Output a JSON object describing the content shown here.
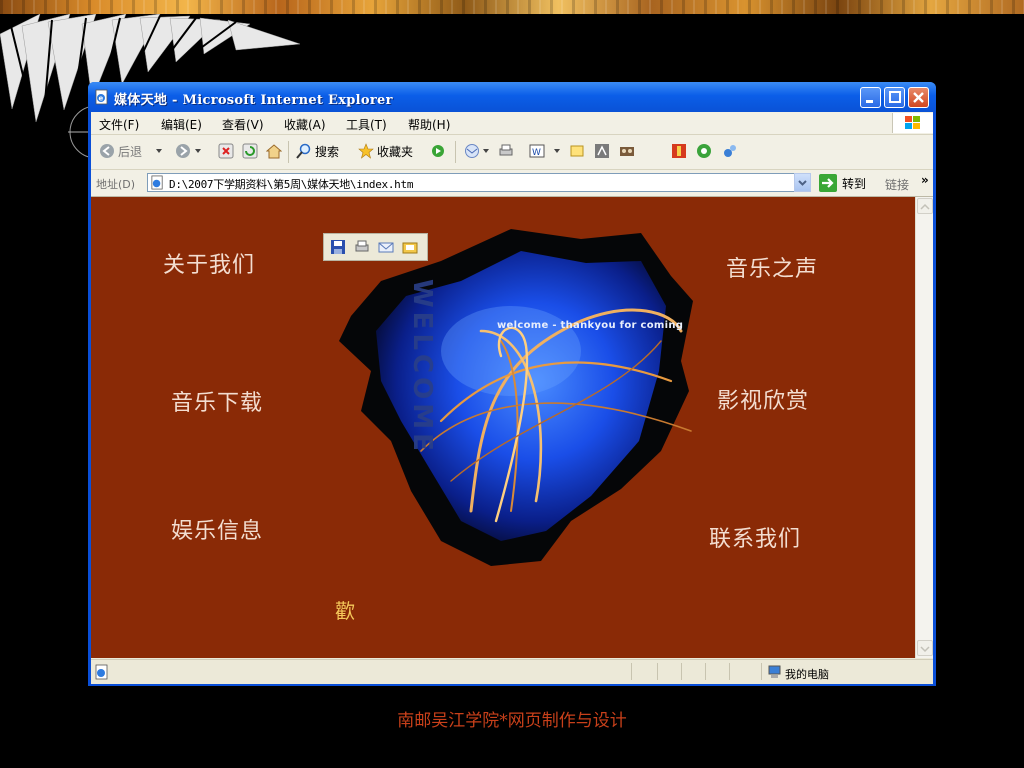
{
  "browser": {
    "title": "媒体天地 - Microsoft Internet Explorer",
    "menu": [
      "文件(F)",
      "编辑(E)",
      "查看(V)",
      "收藏(A)",
      "工具(T)",
      "帮助(H)"
    ],
    "toolbar": {
      "back_label": "后退",
      "search_label": "搜索",
      "favorites_label": "收藏夹"
    },
    "address": {
      "label": "地址(D)",
      "value": "D:\\2007下学期资料\\第5周\\媒体天地\\index.htm",
      "go_label": "转到",
      "links_label": "链接",
      "overflow": "»"
    },
    "status": {
      "zone": "我的电脑"
    }
  },
  "page": {
    "nav": [
      "关于我们",
      "音乐之声",
      "音乐下载",
      "影视欣赏",
      "娱乐信息",
      "联系我们"
    ],
    "welcome_caption": "welcome - thankyou for coming",
    "welcome_vertical": "WELCOME",
    "footer_mark": "歡",
    "background_color": "#8a2a06",
    "nav_text_color": "#f3ddd0"
  },
  "slide": {
    "caption": "南邮吴江学院*网页制作与设计",
    "caption_color": "#c8401a"
  },
  "icons": {
    "title": "ie-page-icon",
    "back": "back-arrow-icon",
    "forward": "forward-arrow-icon",
    "stop": "stop-icon",
    "refresh": "refresh-icon",
    "home": "home-icon",
    "search": "search-icon",
    "favorites": "star-icon",
    "media": "media-icon",
    "mail": "mail-icon",
    "print": "print-icon",
    "edit": "edit-icon",
    "go": "go-arrow-icon",
    "zone": "computer-icon"
  }
}
